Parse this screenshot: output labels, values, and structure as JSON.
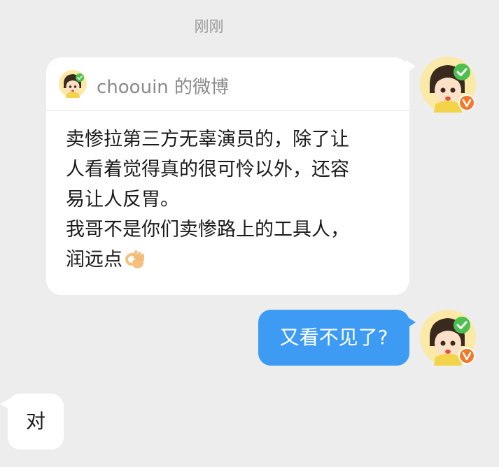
{
  "timestamp": "刚刚",
  "shared_card": {
    "title": "choouin 的微博",
    "avatar_icon": "cartoon-avatar-icon",
    "verified_badge_color": "#4cc04f",
    "lines": [
      "卖惨拉第三方无辜演员的，除了让",
      "人看着觉得真的很可怜以外，还容",
      "易让人反胃。",
      "我哥不是你们卖惨路上的工具人，",
      "润远点"
    ],
    "emoji": "ok-hand-emoji"
  },
  "messages": {
    "outgoing_text": "又看不见了?",
    "incoming_text": "对"
  },
  "colors": {
    "background": "#ededed",
    "outgoing_bubble": "#3d9bf4",
    "incoming_bubble": "#ffffff",
    "vip_badge": "#f07a2a"
  }
}
